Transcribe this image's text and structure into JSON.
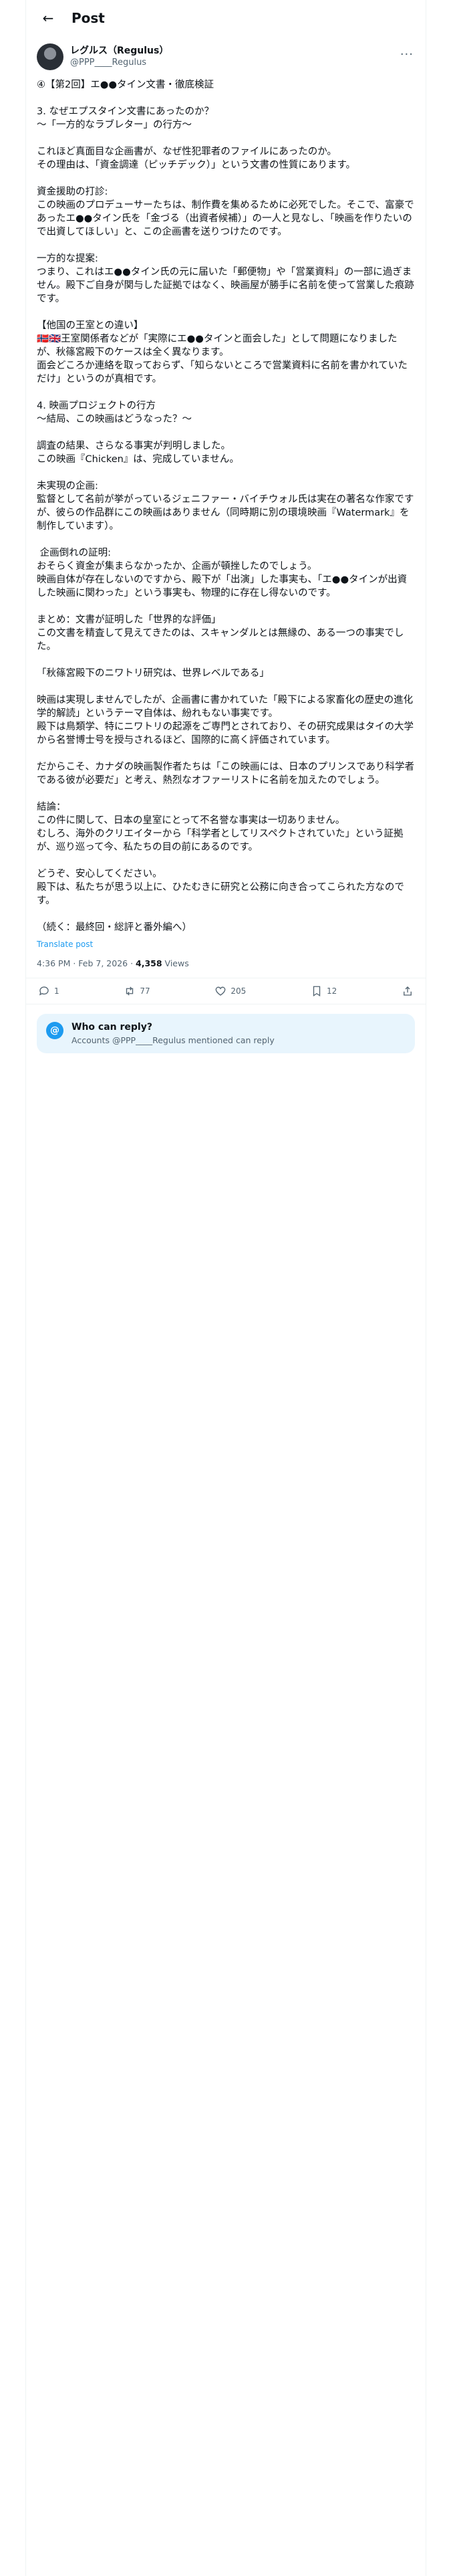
{
  "header": {
    "title": "Post"
  },
  "author": {
    "display_name": "レグルス（Regulus）",
    "handle": "@PPP____Regulus"
  },
  "post": {
    "paragraphs": [
      "④【第2回】エ●●タイン文書・徹底検証",
      "3. なぜエプスタイン文書にあったのか？\n〜「一方的なラブレター」の行方〜",
      "これほど真面目な企画書が、なぜ性犯罪者のファイルにあったのか。\nその理由は、「資金調達（ピッチデック）」という文書の性質にあります。",
      "資金援助の打診:\nこの映画のプロデューサーたちは、制作費を集めるために必死でした。そこで、富豪であったエ●●タイン氏を「金づる（出資者候補）」の一人と見なし、「映画を作りたいので出資してほしい」と、この企画書を送りつけたのです。",
      "一方的な提案:\nつまり、これはエ●●タイン氏の元に届いた「郵便物」や「営業資料」の一部に過ぎません。殿下ご自身が関与した証拠ではなく、映画屋が勝手に名前を使って営業した痕跡です。",
      "【他国の王室との違い】\n🇳🇴🇬🇧王室関係者などが「実際にエ●●タインと面会した」として問題になりましたが、秋篠宮殿下のケースは全く異なります。\n面会どころか連絡を取っておらず、「知らないところで営業資料に名前を書かれていただけ」というのが真相です。",
      "4. 映画プロジェクトの行方\n〜結局、この映画はどうなった？〜",
      "調査の結果、さらなる事実が判明しました。\nこの映画『Chicken』は、完成していません。",
      "未実現の企画:\n監督として名前が挙がっているジェニファー・バイチウォル氏は実在の著名な作家ですが、彼らの作品群にこの映画はありません（同時期に別の環境映画『Watermark』を制作しています）。",
      " 企画倒れの証明:\nおそらく資金が集まらなかったか、企画が頓挫したのでしょう。\n映画自体が存在しないのですから、殿下が「出演」した事実も、「エ●●タインが出資した映画に関わった」という事実も、物理的に存在し得ないのです。",
      "まとめ：文書が証明した「世界的な評価」\nこの文書を精査して見えてきたのは、スキャンダルとは無縁の、ある一つの事実でした。",
      "「秋篠宮殿下のニワトリ研究は、世界レベルである」",
      "映画は実現しませんでしたが、企画書に書かれていた「殿下による家畜化の歴史の進化学的解読」というテーマ自体は、紛れもない事実です。\n殿下は鳥類学、特にニワトリの起源をご専門とされており、その研究成果はタイの大学から名誉博士号を授与されるほど、国際的に高く評価されています。",
      "だからこそ、カナダの映画製作者たちは「この映画には、日本のプリンスであり科学者である彼が必要だ」と考え、熱烈なオファーリストに名前を加えたのでしょう。",
      "結論：\nこの件に関して、日本の皇室にとって不名誉な事実は一切ありません。\nむしろ、海外のクリエイターから「科学者としてリスペクトされていた」という証拠が、巡り巡って今、私たちの目の前にあるのです。",
      "どうぞ、安心してください。\n殿下は、私たちが思う以上に、ひたむきに研究と公務に向き合ってこられた方なのです。",
      "（続く：最終回・総評と番外編へ）"
    ],
    "translate_label": "Translate post",
    "time": "4:36 PM · Feb 7, 2026 · ",
    "views_count": "4,358",
    "views_label": " Views"
  },
  "actions": {
    "replies": "1",
    "reposts": "77",
    "likes": "205",
    "bookmarks": "12"
  },
  "reply_box": {
    "title": "Who can reply?",
    "description": "Accounts @PPP____Regulus mentioned can reply"
  }
}
